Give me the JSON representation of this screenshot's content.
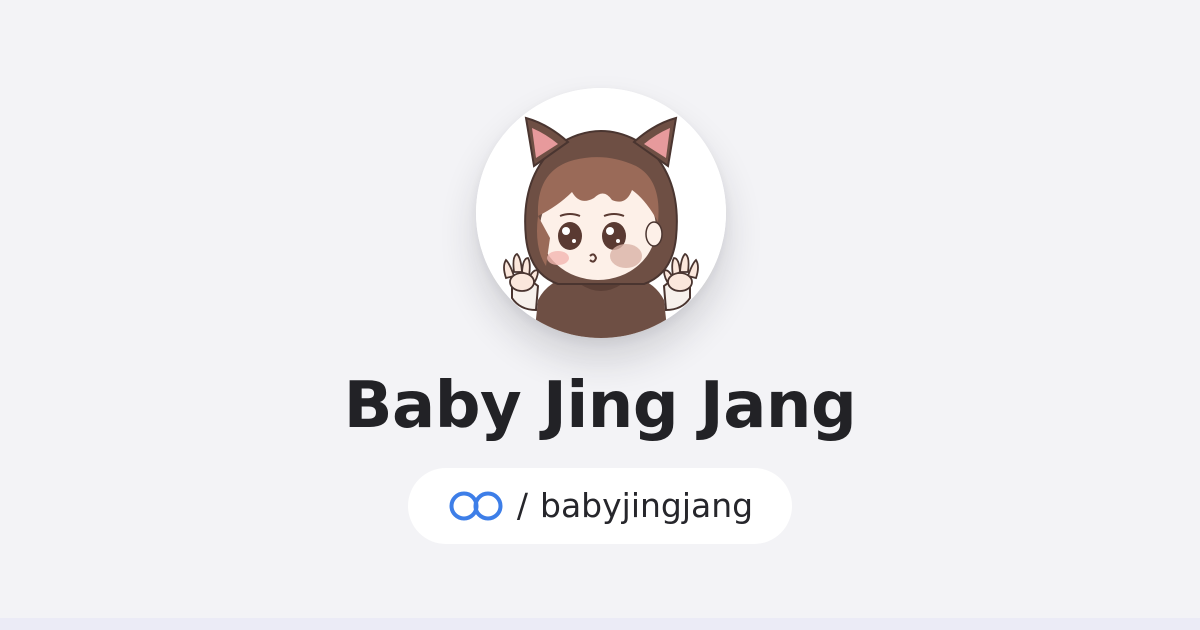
{
  "profile": {
    "display_name": "Baby Jing Jang",
    "handle_separator": "/",
    "handle": "babyjingjang",
    "avatar_icon": "chibi-cat-hood-avatar",
    "brand_icon": "two-linked-rings-logo-icon"
  },
  "colors": {
    "background": "#f3f3f6",
    "card": "#ffffff",
    "text": "#222226",
    "brand_blue": "#3d7ee8"
  }
}
